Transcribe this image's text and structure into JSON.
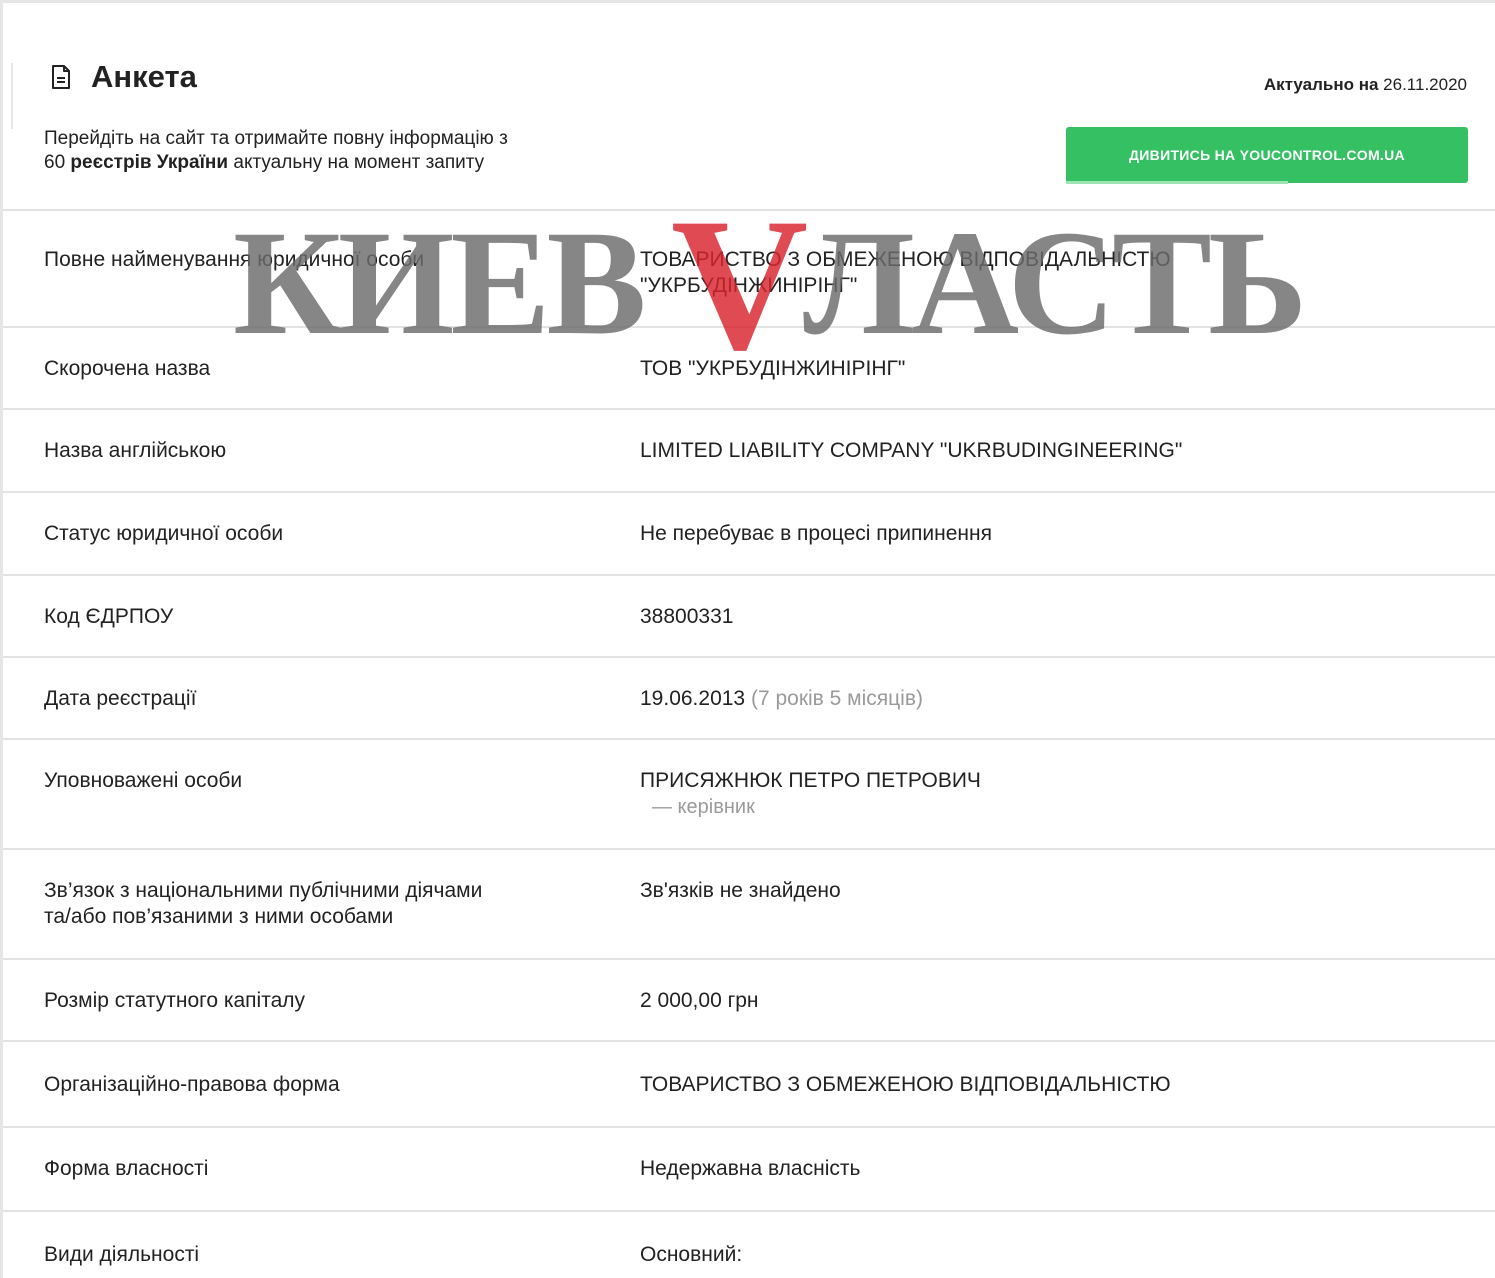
{
  "header": {
    "title": "Анкета",
    "actual_label": "Актуально на",
    "actual_date": "26.11.2020",
    "promo_line1": "Перейдіть на сайт та отримайте повну інформацію з",
    "promo_count": "60",
    "promo_bold": "реєстрів України",
    "promo_rest": "актуальну на момент запиту",
    "cta_label": "ДИВИТИСЬ НА YOUCONTROL.COM.UA"
  },
  "rows": [
    {
      "label": "Повне найменування юридичної особи",
      "value_line1": "ТОВАРИСТВО З ОБМЕЖЕНОЮ ВІДПОВІДАЛЬНІСТЮ",
      "value_line2": "\"УКРБУДІНЖИНІРІНГ\""
    },
    {
      "label": "Скорочена назва",
      "value": "ТОВ \"УКРБУДІНЖИНІРІНГ\""
    },
    {
      "label": "Назва англійською",
      "value": "LIMITED LIABILITY COMPANY \"UKRBUDINGINEERING\""
    },
    {
      "label": "Статус юридичної особи",
      "value": "Не перебуває в процесі припинення"
    },
    {
      "label": "Код ЄДРПОУ",
      "value": "38800331"
    },
    {
      "label": "Дата реєстрації",
      "value": "19.06.2013",
      "extra": "(7 років 5 місяців)"
    },
    {
      "label": "Уповноважені особи",
      "value": "ПРИСЯЖНЮК ПЕТРО ПЕТРОВИЧ",
      "extra": "— керівник"
    },
    {
      "label_line1": "Зв’язок з національними публічними діячами",
      "label_line2": "та/або пов’язаними з ними особами",
      "value": "Зв'язків не знайдено"
    },
    {
      "label": "Розмір статутного капіталу",
      "value": "2 000,00 грн"
    },
    {
      "label": "Організаційно-правова форма",
      "value": "ТОВАРИСТВО З ОБМЕЖЕНОЮ ВІДПОВІДАЛЬНІСТЮ"
    },
    {
      "label": "Форма власності",
      "value": "Недержавна власність"
    },
    {
      "label": "Види діяльності",
      "value": "Основний:"
    }
  ],
  "watermark": {
    "text_left": "КИЕВ",
    "text_right": "ЛАСТЬ",
    "letter_v": "V",
    "color_gray": "#6b6b6b",
    "color_red": "#d9232d"
  },
  "colors": {
    "cta": "#34c063",
    "divider": "#e3e3e3",
    "muted": "#9a9a9a"
  }
}
